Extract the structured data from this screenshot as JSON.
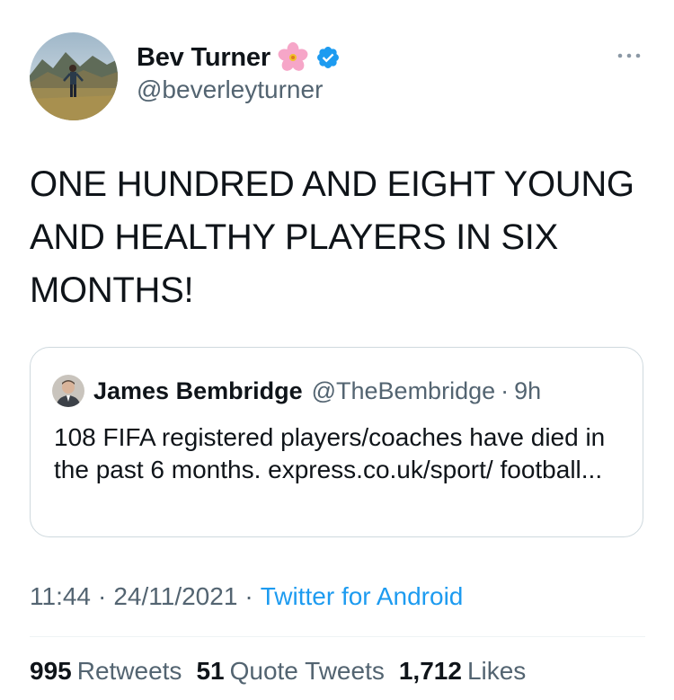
{
  "author": {
    "display_name": "Bev Turner",
    "handle": "@beverleyturner",
    "name_emoji_icon": "cherry-blossom-icon",
    "verified_icon": "verified-badge-icon"
  },
  "tweet": {
    "text": "ONE HUNDRED AND EIGHT YOUNG AND HEALTHY PLAYERS IN SIX MONTHS!",
    "time": "11:44",
    "date": "24/11/2021",
    "separator": "·",
    "source": "Twitter for Android"
  },
  "quoted_tweet": {
    "display_name": "James Bembridge",
    "handle": "@TheBembridge",
    "separator": "·",
    "time_ago": "9h",
    "text": "108 FIFA registered players/coaches have died in the past 6 months. express.co.uk/sport/ football..."
  },
  "stats": {
    "retweets_count": "995",
    "retweets_label": "Retweets",
    "quote_tweets_count": "51",
    "quote_tweets_label": "Quote Tweets",
    "likes_count": "1,712",
    "likes_label": "Likes"
  },
  "colors": {
    "link_blue": "#1d9bf0",
    "secondary_text": "#536471",
    "primary_text": "#0f1419",
    "border": "#cfd9de"
  }
}
